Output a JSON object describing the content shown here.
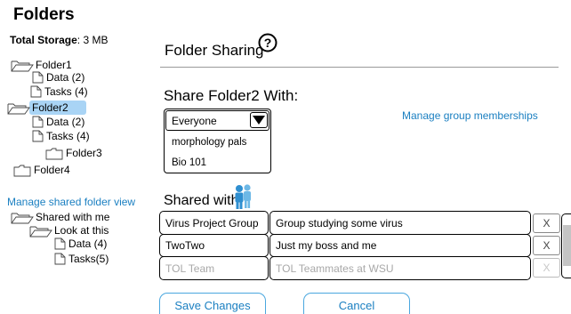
{
  "sidebar": {
    "heading": "Folders",
    "storage_label": "Total Storage",
    "storage_value": ": 3 MB",
    "tree": [
      {
        "label": "Folder1",
        "type": "folder"
      },
      {
        "label": "Data (2)",
        "type": "file"
      },
      {
        "label": "Tasks (4)",
        "type": "file"
      },
      {
        "label": "Folder2",
        "type": "folder",
        "selected": true
      },
      {
        "label": "Data (2)",
        "type": "file"
      },
      {
        "label": "Tasks (4)",
        "type": "file"
      },
      {
        "label": "Folder3",
        "type": "folder"
      },
      {
        "label": "Folder4",
        "type": "folder"
      }
    ],
    "manage_link": "Manage shared folder view",
    "shared_tree": [
      {
        "label": "Shared with me",
        "type": "folder"
      },
      {
        "label": "Look at this",
        "type": "folder"
      },
      {
        "label": "Data (4)",
        "type": "file"
      },
      {
        "label": "Tasks(5)",
        "type": "file"
      }
    ]
  },
  "main": {
    "title": "Folder Sharing",
    "help_icon": "?",
    "share_heading": "Share Folder2 With:",
    "select": {
      "selected": "Everyone",
      "options": [
        "morphology pals",
        "Bio 101"
      ]
    },
    "group_link": "Manage group memberships",
    "shared_with_label": "Shared with:",
    "shares": [
      {
        "group": "Virus Project Group",
        "description": "Group studying some virus",
        "remove": "X",
        "faded": false
      },
      {
        "group": "TwoTwo",
        "description": "Just my boss and me",
        "remove": "X",
        "faded": false
      },
      {
        "group": "TOL Team",
        "description": "TOL Teammates at WSU",
        "remove": "X",
        "faded": true
      }
    ],
    "save_button": "Save Changes",
    "cancel_button": "Cancel"
  },
  "colors": {
    "accent": "#1a7fc1",
    "selected_bg": "#a9d4f5",
    "people_icon": "#3a9bd9"
  },
  "icons": [
    "folder-icon",
    "document-icon",
    "help-icon",
    "dropdown-arrow-icon",
    "people-icon"
  ]
}
